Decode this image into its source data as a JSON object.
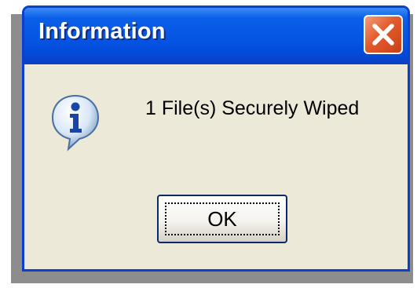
{
  "dialog": {
    "title": "Information",
    "message": "1 File(s) Securely Wiped",
    "ok_label": "OK",
    "icon": "info-icon",
    "close_icon": "close-icon"
  },
  "colors": {
    "titlebar": "#0553e3",
    "window_border": "#0a3fcf",
    "client_bg": "#ece9d8",
    "close_button": "#e35b2b",
    "shadow": "#8d8d8d"
  }
}
